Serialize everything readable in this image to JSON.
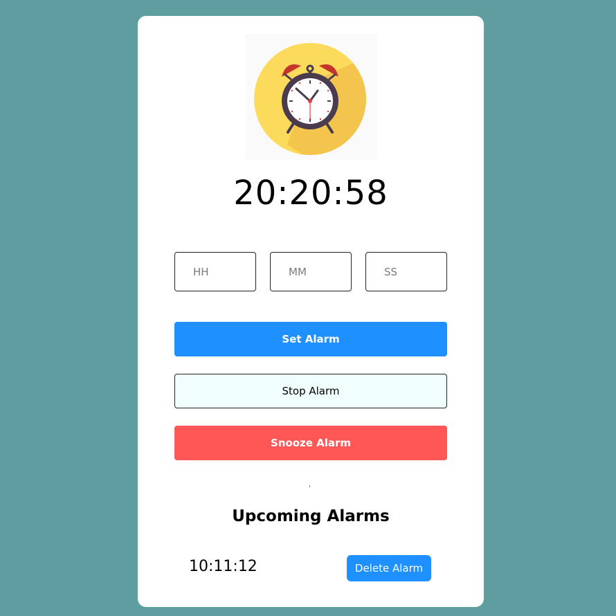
{
  "clock": {
    "current_time": "20:20:58"
  },
  "inputs": {
    "hours_placeholder": "HH",
    "minutes_placeholder": "MM",
    "seconds_placeholder": "SS"
  },
  "buttons": {
    "set_label": "Set Alarm",
    "stop_label": "Stop Alarm",
    "snooze_label": "Snooze Alarm"
  },
  "upcoming": {
    "title": "Upcoming Alarms",
    "alarms": [
      {
        "time": "10:11:12",
        "delete_label": "Delete Alarm"
      }
    ]
  },
  "icons": {
    "logo": "alarm-clock-icon"
  },
  "colors": {
    "page_background": "#5f9ea0",
    "card_background": "#ffffff",
    "set_button": "#1e90ff",
    "stop_button": "#f0fffe",
    "snooze_button": "#ff5656",
    "delete_button": "#1e90ff",
    "logo_circle": "#fbd55a"
  }
}
